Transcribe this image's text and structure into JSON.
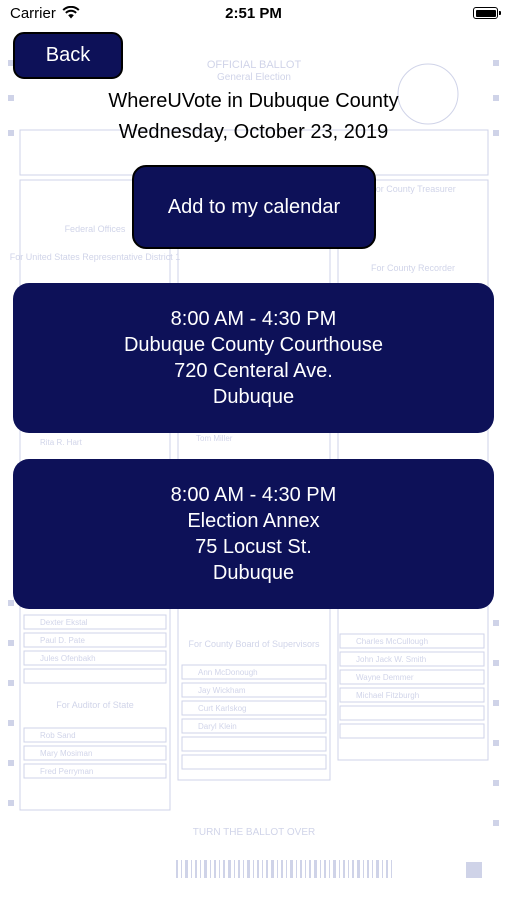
{
  "status_bar": {
    "carrier": "Carrier",
    "time": "2:51 PM"
  },
  "back_label": "Back",
  "title": "WhereUVote in Dubuque County",
  "date": "Wednesday, October 23, 2019",
  "calendar_label": "Add to my calendar",
  "locations": [
    {
      "hours": "8:00 AM - 4:30 PM",
      "name": "Dubuque County Courthouse",
      "address": "720 Centeral Ave.",
      "city": "Dubuque"
    },
    {
      "hours": "8:00 AM - 4:30 PM",
      "name": "Election Annex",
      "address": "75 Locust St.",
      "city": "Dubuque"
    }
  ],
  "background_ballot": {
    "header": [
      "OFFICIAL BALLOT",
      "General Election"
    ],
    "sections": [
      "Federal Offices",
      "For United States Representative District 1",
      "For Auditor of State",
      "For County Board of Supervisors",
      "For County Treasurer",
      "For County Recorder"
    ],
    "candidates": [
      "Rita R. Hart",
      "Tom Miller",
      "Dexter Ekstal",
      "Paul D. Pate",
      "Jules Ofenbakh",
      "Rob Sand",
      "Mary Mosiman",
      "Fred Perryman",
      "Ann McDonough",
      "Jay Wickham",
      "Curt Karlskog",
      "Daryl Klein",
      "Charles McCullough",
      "John Jack W. Smith",
      "Wayne Demmer",
      "Michael Fitzburgh"
    ],
    "footer": "TURN THE BALLOT OVER"
  },
  "colors": {
    "accent": "#0d1158",
    "text_on_accent": "#ffffff"
  }
}
